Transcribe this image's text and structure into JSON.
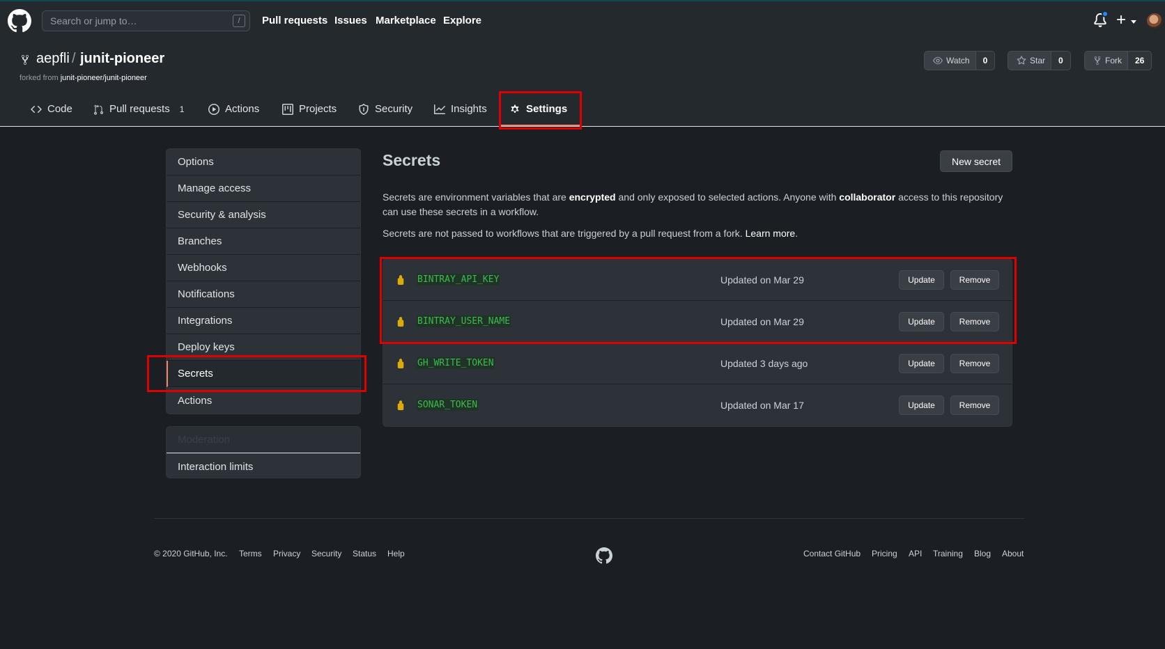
{
  "topbar": {
    "search_placeholder": "Search or jump to…",
    "slash_key": "/",
    "nav": [
      "Pull requests",
      "Issues",
      "Marketplace",
      "Explore"
    ],
    "plus_label": "+"
  },
  "repo": {
    "owner": "aepfli",
    "separator": "/",
    "name": "junit-pioneer",
    "forked_prefix": "forked from",
    "forked_source": "junit-pioneer/junit-pioneer",
    "watch": {
      "label": "Watch",
      "count": "0"
    },
    "star": {
      "label": "Star",
      "count": "0"
    },
    "fork": {
      "label": "Fork",
      "count": "26"
    }
  },
  "tabs": [
    {
      "label": "Code",
      "icon": "code-icon"
    },
    {
      "label": "Pull requests",
      "icon": "git-pull-request-icon",
      "count": "1"
    },
    {
      "label": "Actions",
      "icon": "play-icon"
    },
    {
      "label": "Projects",
      "icon": "project-icon"
    },
    {
      "label": "Security",
      "icon": "shield-icon"
    },
    {
      "label": "Insights",
      "icon": "graph-icon"
    },
    {
      "label": "Settings",
      "icon": "gear-icon",
      "selected": true
    }
  ],
  "sidebar": {
    "items": [
      "Options",
      "Manage access",
      "Security & analysis",
      "Branches",
      "Webhooks",
      "Notifications",
      "Integrations",
      "Deploy keys",
      "Secrets",
      "Actions"
    ],
    "selected": "Secrets",
    "moderation_heading": "Moderation",
    "moderation_items": [
      "Interaction limits"
    ]
  },
  "main": {
    "title": "Secrets",
    "new_secret_label": "New secret",
    "desc1_a": "Secrets are environment variables that are ",
    "desc1_b": "encrypted",
    "desc1_c": " and only exposed to selected actions. Anyone with ",
    "desc1_d": "collaborator",
    "desc1_e": " access to this repository can use these secrets in a workflow.",
    "desc2": "Secrets are not passed to workflows that are triggered by a pull request from a fork.",
    "learn_more": "Learn more",
    "period": ".",
    "update_label": "Update",
    "remove_label": "Remove",
    "secrets": [
      {
        "name": "BINTRAY_API_KEY",
        "updated": "Updated on Mar 29"
      },
      {
        "name": "BINTRAY_USER_NAME",
        "updated": "Updated on Mar 29"
      },
      {
        "name": "GH_WRITE_TOKEN",
        "updated": "Updated 3 days ago"
      },
      {
        "name": "SONAR_TOKEN",
        "updated": "Updated on Mar 17"
      }
    ]
  },
  "footer": {
    "copyright": "© 2020 GitHub, Inc.",
    "left_links": [
      "Terms",
      "Privacy",
      "Security",
      "Status",
      "Help"
    ],
    "right_links": [
      "Contact GitHub",
      "Pricing",
      "API",
      "Training",
      "Blog",
      "About"
    ]
  },
  "colors": {
    "highlight": "#e00000",
    "accent_orange": "#f9826c",
    "secret_green": "#3fb950",
    "lock_yellow": "#dbab09"
  }
}
